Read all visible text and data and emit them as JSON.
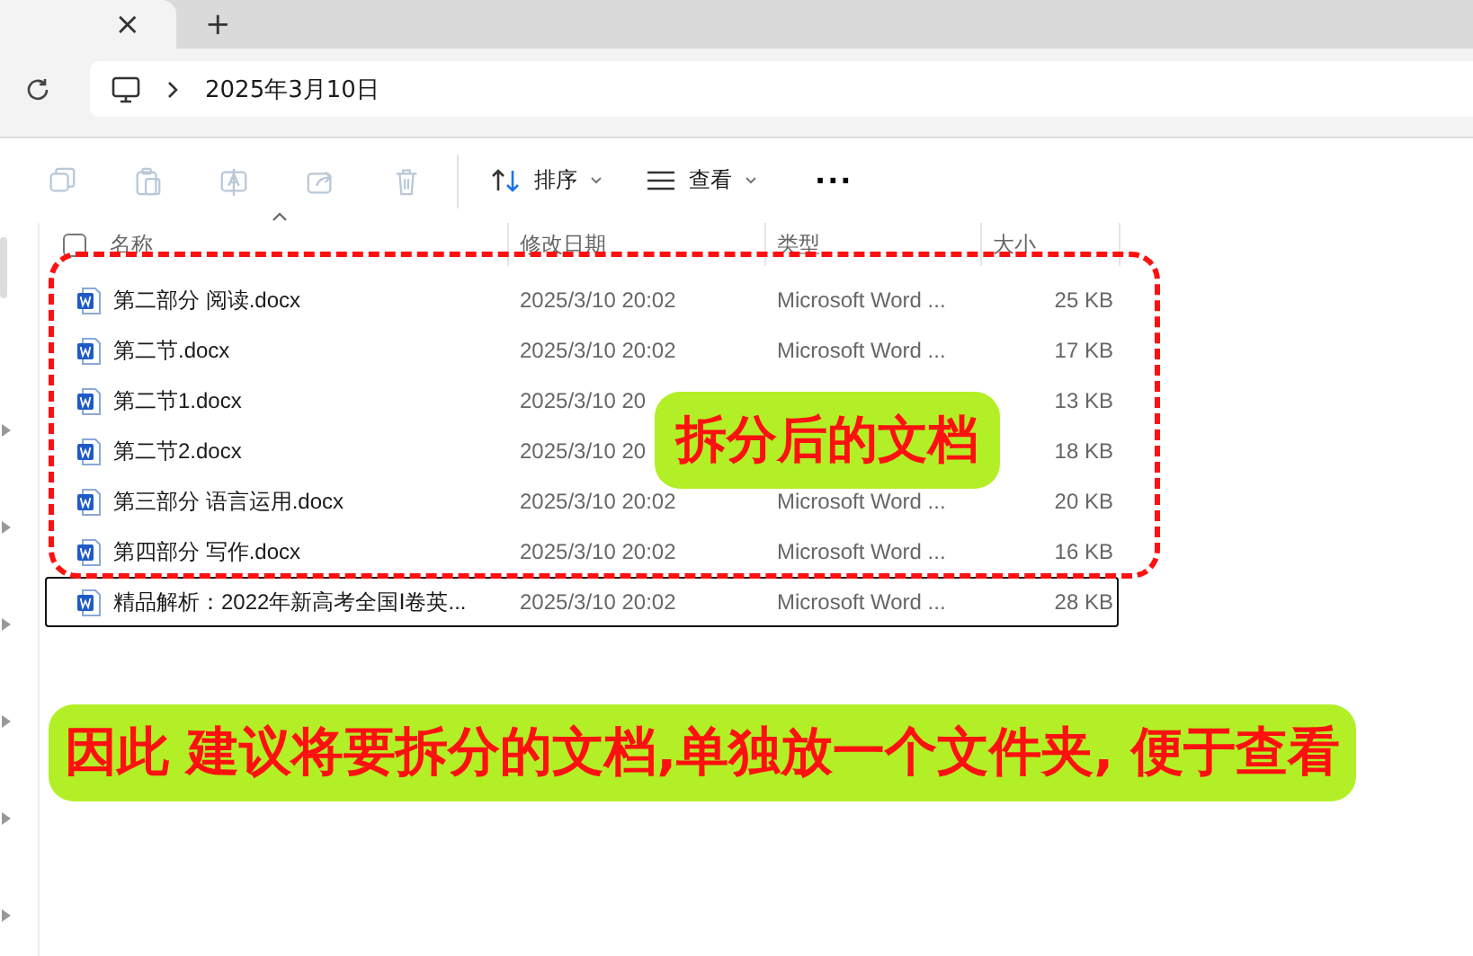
{
  "tab": {
    "close": "×"
  },
  "new_tab": "+",
  "address": {
    "crumbs": [
      "2025年3月10日"
    ]
  },
  "toolbar": {
    "actions": [
      {
        "kind": "copy",
        "disabled": true
      },
      {
        "kind": "paste",
        "disabled": true
      },
      {
        "kind": "rename",
        "disabled": true
      },
      {
        "kind": "share",
        "disabled": true
      },
      {
        "kind": "delete",
        "disabled": true
      }
    ],
    "menus": [
      {
        "kind": "sort",
        "label": "排序"
      },
      {
        "kind": "view",
        "label": "查看"
      }
    ],
    "more": "···"
  },
  "nav_pane": {
    "items": [
      {
        "expanded": false
      },
      {
        "expanded": false
      },
      {
        "expanded": false
      },
      {
        "expanded": false
      },
      {
        "expanded": false
      },
      {
        "expanded": false
      }
    ]
  },
  "table": {
    "select_all": {
      "checked": false
    },
    "columns": [
      "名称",
      "修改日期",
      "类型",
      "大小"
    ],
    "rows": [
      {
        "name": "第二部分 阅读.docx",
        "modified": "2025/3/10 20:02",
        "type": "Microsoft Word ...",
        "size": "25 KB",
        "focused": false
      },
      {
        "name": "第二节.docx",
        "modified": "2025/3/10 20:02",
        "type": "Microsoft Word ...",
        "size": "17 KB",
        "focused": false
      },
      {
        "name": "第二节1.docx",
        "modified": "2025/3/10 20",
        "size": "13 KB",
        "focused": false
      },
      {
        "name": "第二节2.docx",
        "modified": "2025/3/10 20",
        "size": "18 KB",
        "focused": false
      },
      {
        "name": "第三部分 语言运用.docx",
        "modified": "2025/3/10 20:02",
        "type": "Microsoft Word ...",
        "size": "20 KB",
        "focused": false
      },
      {
        "name": "第四部分 写作.docx",
        "modified": "2025/3/10 20:02",
        "type": "Microsoft Word ...",
        "size": "16 KB",
        "focused": false
      },
      {
        "name": "精品解析：2022年新高考全国Ⅰ卷英...",
        "modified": "2025/3/10 20:02",
        "type": "Microsoft Word ...",
        "size": "28 KB",
        "focused": true
      }
    ]
  },
  "annotations": [
    {
      "kind": "callout",
      "text": "拆分后的文档"
    },
    {
      "kind": "banner",
      "text": "因此 建议将要拆分的文档,单独放一个文件夹, 便于查看"
    }
  ]
}
